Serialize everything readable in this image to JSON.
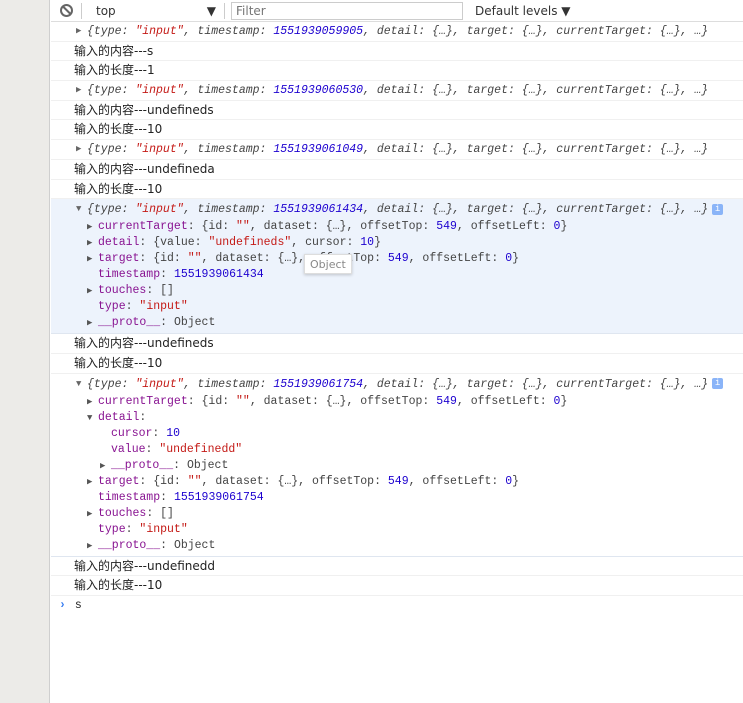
{
  "toolbar": {
    "context": "top",
    "filter_placeholder": "Filter",
    "levels": "Default levels"
  },
  "log": [
    {
      "type": "obj",
      "ts": "1551939059905"
    },
    {
      "type": "text",
      "text": "输入的内容---s"
    },
    {
      "type": "text",
      "text": "输入的长度---1"
    },
    {
      "type": "obj",
      "ts": "1551939060530"
    },
    {
      "type": "text",
      "text": "输入的内容---undefineds"
    },
    {
      "type": "text",
      "text": "输入的长度---10"
    },
    {
      "type": "obj",
      "ts": "1551939061049"
    },
    {
      "type": "text",
      "text": "输入的内容---undefineda"
    },
    {
      "type": "text",
      "text": "输入的长度---10"
    }
  ],
  "summary": {
    "p1": "{type: ",
    "type": "\"input\"",
    "p2": ", timestamp: ",
    "p3": ", detail: {…}, target: {…}, currentTarget: {…}, …}"
  },
  "group1": {
    "ts": "1551939061434",
    "detail_value": "\"undefineds\"",
    "cursor": "10",
    "offsetTop": "549",
    "offsetLeft": "0",
    "tooltip": "Object"
  },
  "after1": [
    "输入的内容---undefineds",
    "输入的长度---10"
  ],
  "group2": {
    "ts": "1551939061754",
    "detail_value": "\"undefinedd\"",
    "cursor": "10",
    "offsetTop": "549",
    "offsetLeft": "0"
  },
  "after2": [
    "输入的内容---undefinedd",
    "输入的长度---10"
  ],
  "labels": {
    "currentTarget": "currentTarget",
    "detail": "detail",
    "target": "target",
    "timestamp": "timestamp",
    "touches": "touches",
    "type": "type",
    "proto": "__proto__",
    "cursor": "cursor",
    "value": "value",
    "object": "Object",
    "empty_arr": "[]",
    "type_val": "\"input\"",
    "id_empty": "\"\""
  },
  "prompt": {
    "input": "s"
  }
}
